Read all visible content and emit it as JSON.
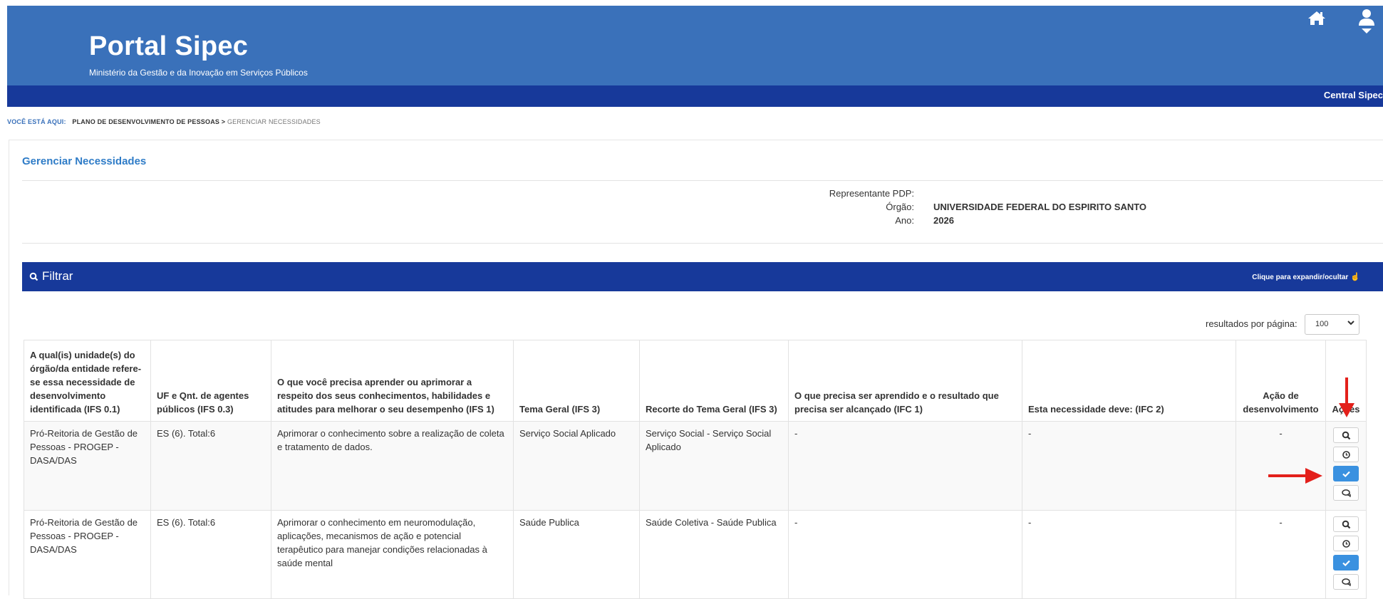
{
  "header": {
    "title": "Portal Sipec",
    "subtitle": "Ministério da Gestão e da Inovação em Serviços Públicos",
    "home_icon": "home-icon",
    "user_icon": "user-icon",
    "bar_link": "Central Sipec"
  },
  "breadcrumb": {
    "label": "VOCÊ ESTÁ AQUI:",
    "item1": "PLANO DE DESENVOLVIMENTO DE PESSOAS >",
    "item2": "GERENCIAR NECESSIDADES"
  },
  "page": {
    "title": "Gerenciar Necessidades"
  },
  "info": {
    "rep_label": "Representante PDP:",
    "orgao_label": "Órgão:",
    "orgao_value": "UNIVERSIDADE FEDERAL DO ESPIRITO SANTO",
    "ano_label": "Ano:",
    "ano_value": "2026"
  },
  "filter": {
    "label": "Filtrar",
    "toggle": "Clique para expandir/ocultar",
    "icon": "search-icon"
  },
  "pagination": {
    "label": "resultados por página:",
    "value": "100"
  },
  "table": {
    "headers": [
      "A qual(is) unidade(s) do órgão/da entidade refere-se essa necessidade de desenvolvimento identificada (IFS 0.1)",
      "UF e Qnt. de agentes públicos (IFS 0.3)",
      "O que você precisa aprender ou aprimorar a respeito dos seus conhecimentos, habilidades e atitudes para melhorar o seu desempenho (IFS 1)",
      "Tema Geral (IFS 3)",
      "Recorte do Tema Geral (IFS 3)",
      "O que precisa ser aprendido e o resultado que precisa ser alcançado (IFC 1)",
      "Esta necessidade deve: (IFC 2)",
      "Ação de desenvolvimento",
      "Ações"
    ],
    "rows": [
      {
        "unidade": "Pró-Reitoria de Gestão de Pessoas - PROGEP - DASA/DAS",
        "uf": "ES (6). Total:6",
        "aprender": "Aprimorar o conhecimento sobre a realização de coleta e tratamento de dados.",
        "tema": "Serviço Social Aplicado",
        "recorte": "Serviço Social - Serviço Social Aplicado",
        "resultado": "-",
        "deve": "-",
        "acao": "-"
      },
      {
        "unidade": "Pró-Reitoria de Gestão de Pessoas - PROGEP - DASA/DAS",
        "uf": "ES (6). Total:6",
        "aprender": "Aprimorar o conhecimento em neuromodulação, aplicações, mecanismos de ação e potencial terapêutico para manejar condições relacionadas à saúde mental",
        "tema": "Saúde Publica",
        "recorte": "Saúde Coletiva - Saúde Publica",
        "resultado": "-",
        "deve": "-",
        "acao": "-"
      }
    ],
    "action_icons": [
      "search-icon",
      "clock-icon",
      "check-icon",
      "comment-icon"
    ]
  },
  "annotations": {
    "arrow_color": "#e3201b"
  }
}
